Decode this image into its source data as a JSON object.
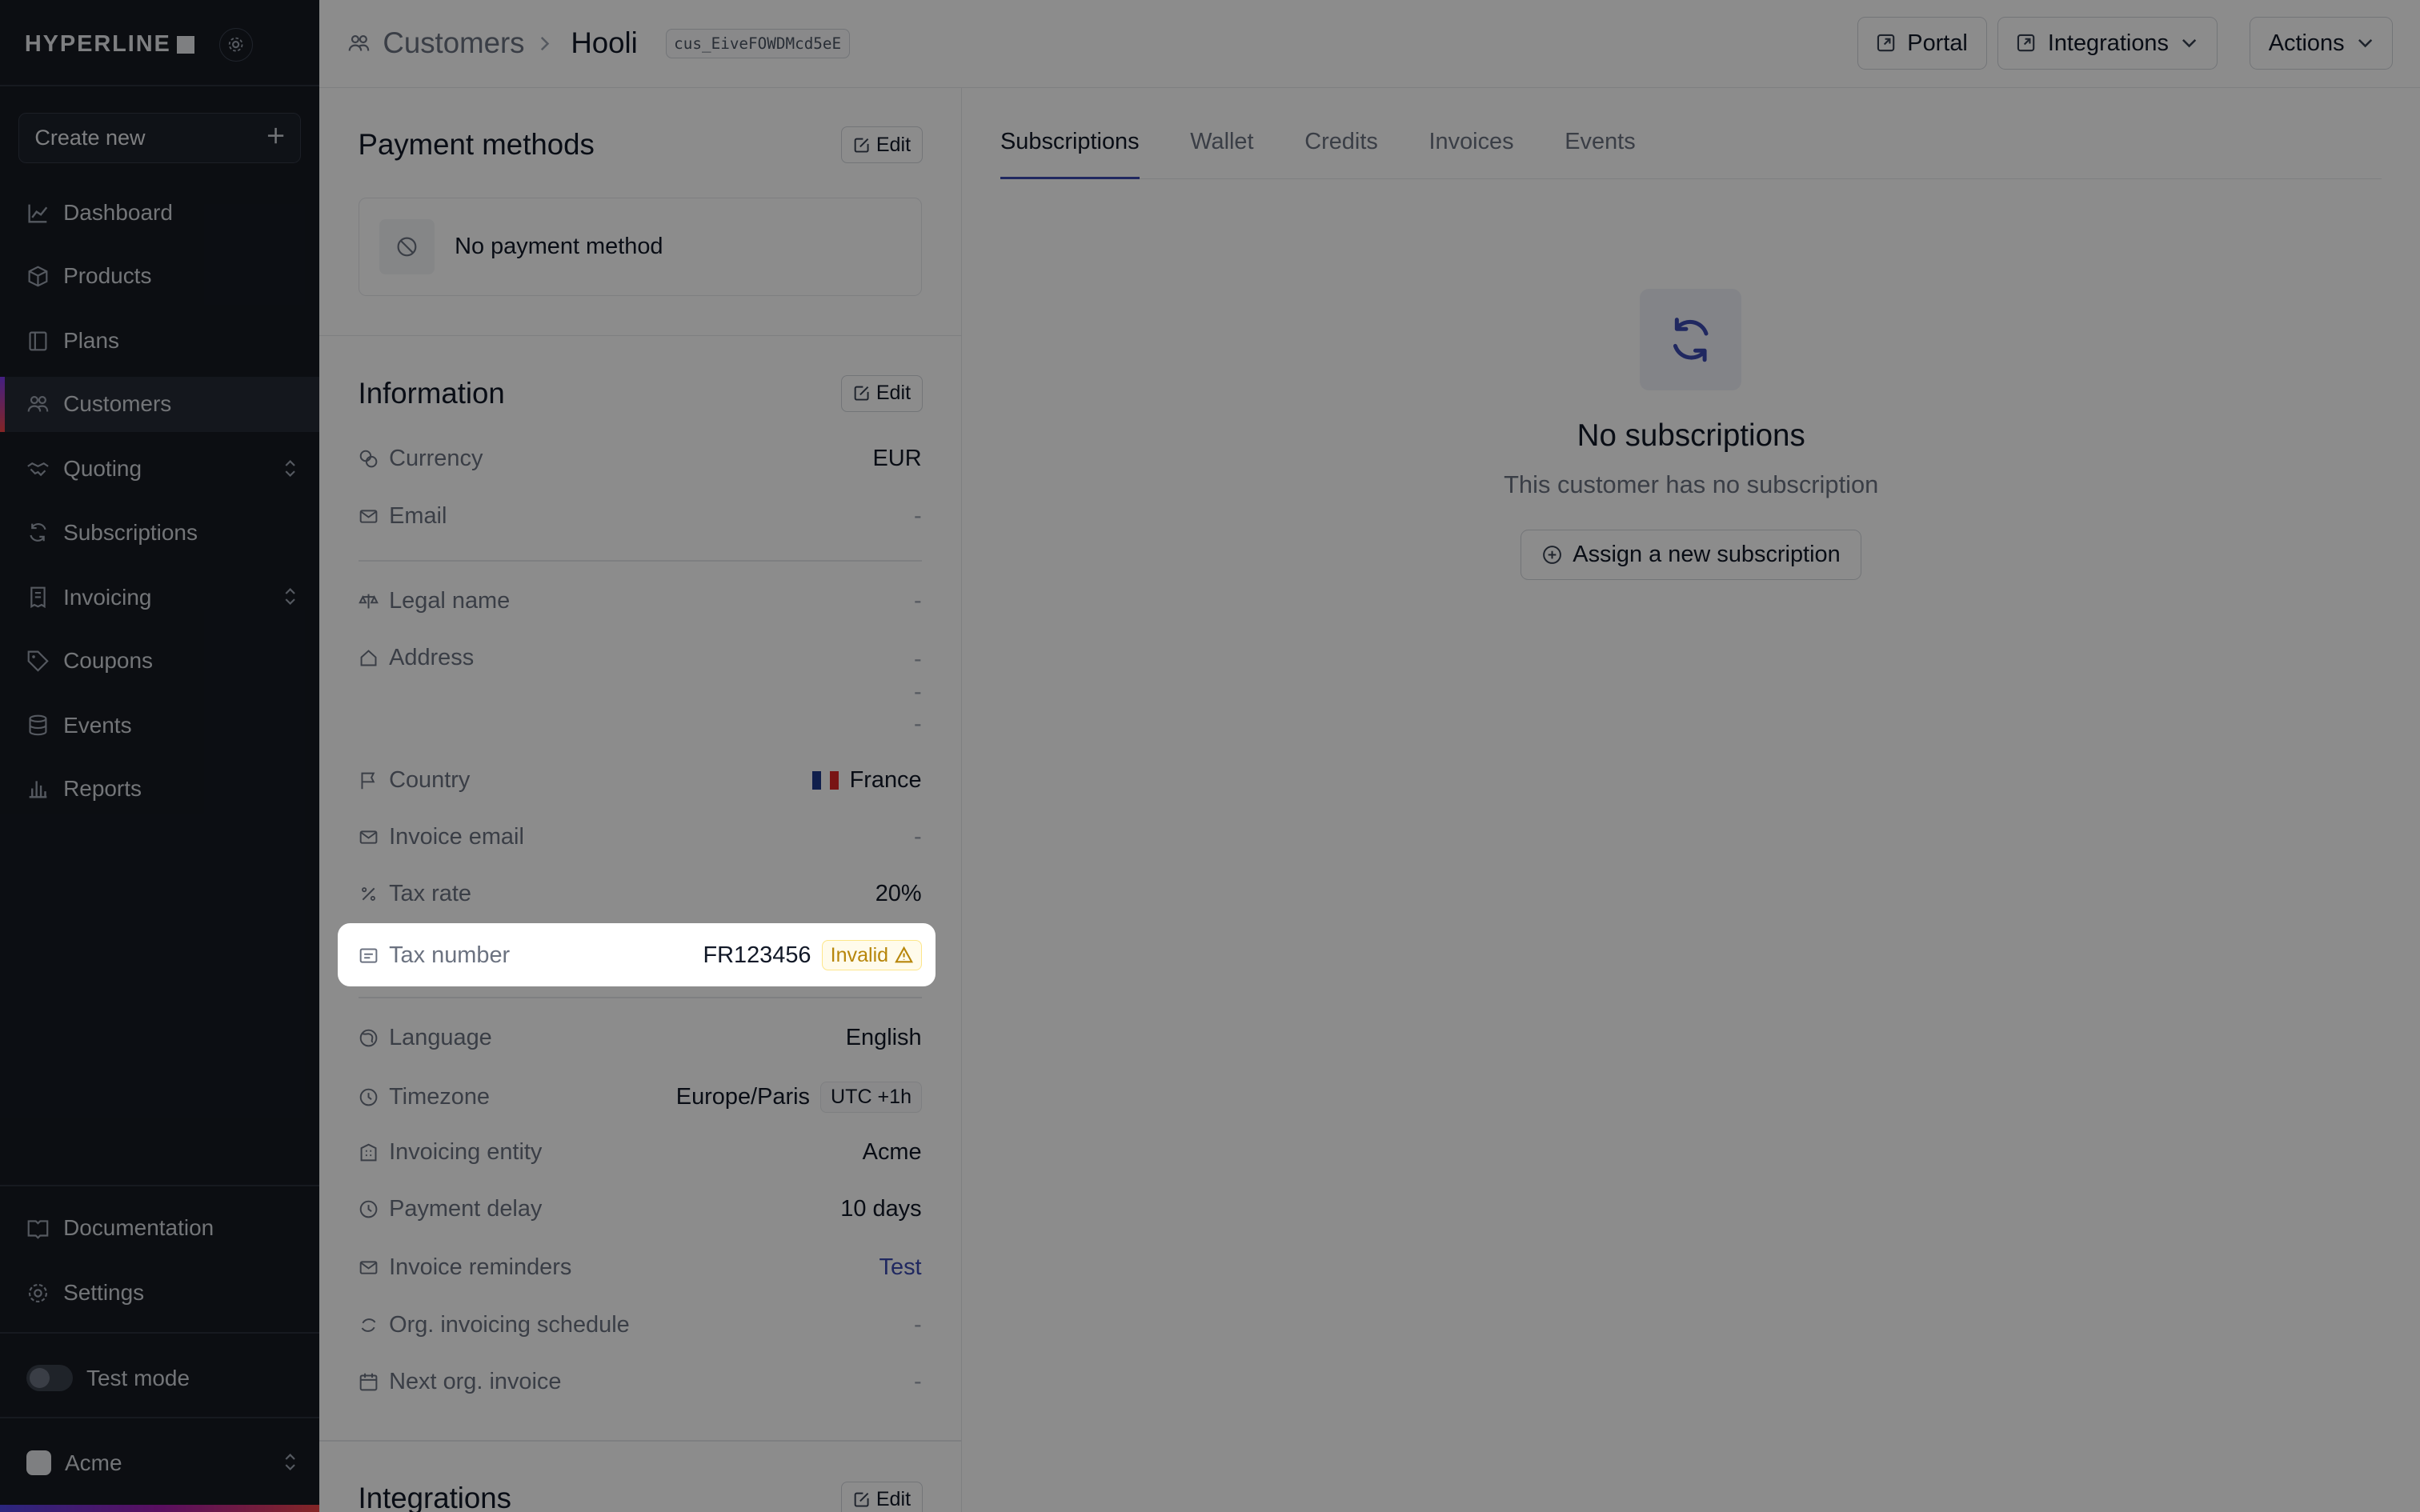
{
  "brand": {
    "name": "HYPERLINE"
  },
  "sidebar": {
    "create_new": "Create new",
    "items": [
      {
        "label": "Dashboard",
        "icon": "chart-line-icon"
      },
      {
        "label": "Products",
        "icon": "cube-icon"
      },
      {
        "label": "Plans",
        "icon": "book-icon"
      },
      {
        "label": "Customers",
        "icon": "users-icon"
      },
      {
        "label": "Quoting",
        "icon": "handshake-icon"
      },
      {
        "label": "Subscriptions",
        "icon": "refresh-icon"
      },
      {
        "label": "Invoicing",
        "icon": "receipt-icon"
      },
      {
        "label": "Coupons",
        "icon": "tag-icon"
      },
      {
        "label": "Events",
        "icon": "database-icon"
      },
      {
        "label": "Reports",
        "icon": "bar-chart-icon"
      }
    ],
    "documentation": "Documentation",
    "settings": "Settings",
    "test_mode": "Test mode",
    "org": "Acme"
  },
  "header": {
    "breadcrumb_parent": "Customers",
    "title": "Hooli",
    "customer_id": "cus_EiveFOWDMcd5eE",
    "portal": "Portal",
    "integrations": "Integrations",
    "actions": "Actions"
  },
  "payment_methods": {
    "title": "Payment methods",
    "edit": "Edit",
    "empty": "No payment method"
  },
  "information": {
    "title": "Information",
    "edit": "Edit",
    "currency": {
      "label": "Currency",
      "value": "EUR"
    },
    "email": {
      "label": "Email",
      "value": "-"
    },
    "legal_name": {
      "label": "Legal name",
      "value": "-"
    },
    "address": {
      "label": "Address",
      "value": "-"
    },
    "country": {
      "label": "Country",
      "value": "France"
    },
    "invoice_email": {
      "label": "Invoice email",
      "value": "-"
    },
    "tax_rate": {
      "label": "Tax rate",
      "value": "20%"
    },
    "tax_number": {
      "label": "Tax number",
      "value": "FR123456",
      "status": "Invalid"
    },
    "language": {
      "label": "Language",
      "value": "English"
    },
    "timezone": {
      "label": "Timezone",
      "value": "Europe/Paris",
      "offset": "UTC +1h"
    },
    "invoicing_entity": {
      "label": "Invoicing entity",
      "value": "Acme"
    },
    "payment_delay": {
      "label": "Payment delay",
      "value": "10 days"
    },
    "invoice_reminders": {
      "label": "Invoice reminders",
      "value": "Test"
    },
    "org_invoicing_schedule": {
      "label": "Org. invoicing schedule",
      "value": "-"
    },
    "next_org_invoice": {
      "label": "Next org. invoice",
      "value": "-"
    }
  },
  "integrations_section": {
    "title": "Integrations",
    "edit": "Edit"
  },
  "tabs": [
    "Subscriptions",
    "Wallet",
    "Credits",
    "Invoices",
    "Events"
  ],
  "empty_state": {
    "title": "No subscriptions",
    "subtitle": "This customer has no subscription",
    "button": "Assign a new subscription"
  },
  "colors": {
    "sidebar_bg": "#161a22",
    "accent": "#3b4ab0",
    "warning": "#b7860b"
  }
}
